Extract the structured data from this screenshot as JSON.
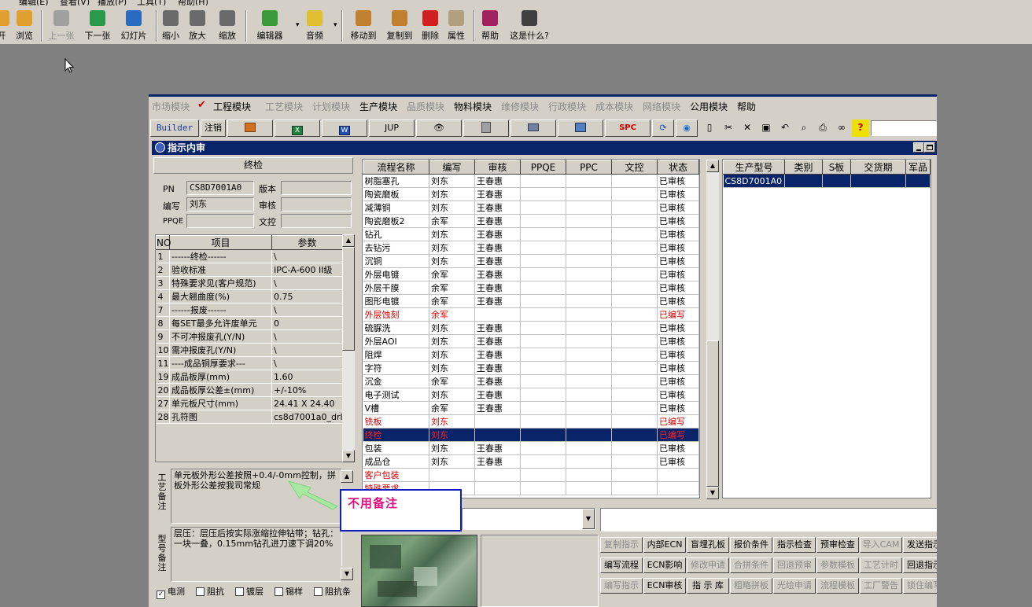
{
  "viewer": {
    "menu": [
      "编辑(E)",
      "查看(V)",
      "播放(P)",
      "工具(T)",
      "帮助(H)"
    ],
    "toolbar": [
      {
        "label": "开",
        "icon": "open-folder-icon",
        "color": "#e0a030"
      },
      {
        "label": "浏览",
        "icon": "browse-icon",
        "color": "#e0a030"
      },
      {
        "label": "上一张",
        "icon": "previous-icon",
        "color": "#a0a0a0",
        "disabled": true
      },
      {
        "label": "下一张",
        "icon": "next-icon",
        "color": "#2a9a4a"
      },
      {
        "label": "幻灯片",
        "icon": "slideshow-icon",
        "color": "#2a6ac0"
      },
      {
        "label": "缩小",
        "icon": "zoom-out-icon",
        "color": "#6a6a6a"
      },
      {
        "label": "放大",
        "icon": "zoom-in-icon",
        "color": "#6a6a6a"
      },
      {
        "label": "缩放",
        "icon": "zoom-icon",
        "color": "#6a6a6a"
      },
      {
        "label": "编辑器",
        "icon": "editor-icon",
        "color": "#3a9a3a"
      },
      {
        "label": "音频",
        "icon": "audio-icon",
        "color": "#e0c030"
      },
      {
        "label": "移动到",
        "icon": "move-to-icon",
        "color": "#c08030"
      },
      {
        "label": "复制到",
        "icon": "copy-to-icon",
        "color": "#c08030"
      },
      {
        "label": "删除",
        "icon": "delete-icon",
        "color": "#d02020"
      },
      {
        "label": "属性",
        "icon": "properties-icon",
        "color": "#b0a080"
      },
      {
        "label": "帮助",
        "icon": "help-book-icon",
        "color": "#a02060"
      },
      {
        "label": "这是什么?",
        "icon": "whats-this-icon",
        "color": "#404040"
      }
    ]
  },
  "app": {
    "modules": [
      {
        "label": "市场模块",
        "disabled": true
      },
      {
        "label": "工程模块",
        "disabled": false
      },
      {
        "label": "工艺模块",
        "disabled": true
      },
      {
        "label": "计划模块",
        "disabled": true
      },
      {
        "label": "生产模块",
        "disabled": false
      },
      {
        "label": "品质模块",
        "disabled": true
      },
      {
        "label": "物料模块",
        "disabled": false
      },
      {
        "label": "维修模块",
        "disabled": true
      },
      {
        "label": "行政模块",
        "disabled": true
      },
      {
        "label": "成本模块",
        "disabled": true
      },
      {
        "label": "网络模块",
        "disabled": true
      },
      {
        "label": "公用模块",
        "disabled": false
      },
      {
        "label": "帮助",
        "disabled": false
      }
    ],
    "toolbar": {
      "builder": "Builder",
      "logout": "注销",
      "jup": "JUP",
      "spc": "SPC"
    },
    "window_title": "指示内审",
    "form": {
      "section": "终检",
      "pn_label": "PN",
      "pn_value": "CS8D7001A0",
      "version_label": "版本",
      "version_value": "",
      "author_label": "编写",
      "author_value": "刘东",
      "review_label": "审核",
      "review_value": "",
      "ppqe_label": "PPQE",
      "ppqe_value": "",
      "doc_label": "文控",
      "doc_value": ""
    },
    "params": {
      "headers": [
        "NO",
        "项目",
        "参数"
      ],
      "rows": [
        [
          "1",
          "------终检------",
          "\\"
        ],
        [
          "2",
          "验收标准",
          "IPC-A-600 II级"
        ],
        [
          "3",
          "特殊要求见(客户规范)",
          "\\"
        ],
        [
          "4",
          "最大翘曲度(%)",
          "0.75"
        ],
        [
          "7",
          "------报废------",
          "\\"
        ],
        [
          "8",
          "每SET最多允许废单元",
          "0"
        ],
        [
          "9",
          "不可冲报废孔(Y/N)",
          "\\"
        ],
        [
          "10",
          "需冲报废孔(Y/N)",
          "\\"
        ],
        [
          "11",
          "----成品铜厚要求---",
          "\\"
        ],
        [
          "19",
          "成品板厚(mm)",
          "1.60"
        ],
        [
          "20",
          "成品板厚公差±(mm)",
          "+/-10%"
        ],
        [
          "27",
          "单元板尺寸(mm)",
          "24.41 X 24.40"
        ],
        [
          "28",
          "孔符图",
          "cs8d7001a0_drl"
        ]
      ]
    },
    "process_note_label": "工艺备注",
    "process_note": "单元板外形公差按照+0.4/-0mm控制，拼板外形公差按我司常规",
    "model_note_label": "型号备注",
    "model_note": "层压：层压后按实际涨缩拉伸钻带；钻孔：一块一叠，0.15mm钻孔进刀速下调20%",
    "checkboxes": [
      {
        "label": "电测",
        "checked": true
      },
      {
        "label": "阻抗",
        "checked": false
      },
      {
        "label": "镀层",
        "checked": false
      },
      {
        "label": "锡样",
        "checked": false
      },
      {
        "label": "阻抗条",
        "checked": false
      }
    ],
    "flow": {
      "headers": [
        "流程名称",
        "编写",
        "审核",
        "PPQE",
        "PPC",
        "文控",
        "状态"
      ],
      "rows": [
        {
          "cells": [
            "树脂塞孔",
            "刘东",
            "王春惠",
            "",
            "",
            "",
            "已审核"
          ],
          "style": "normal"
        },
        {
          "cells": [
            "陶瓷磨板",
            "刘东",
            "王春惠",
            "",
            "",
            "",
            "已审核"
          ],
          "style": "normal"
        },
        {
          "cells": [
            "减薄铜",
            "刘东",
            "王春惠",
            "",
            "",
            "",
            "已审核"
          ],
          "style": "normal"
        },
        {
          "cells": [
            "陶瓷磨板2",
            "余军",
            "王春惠",
            "",
            "",
            "",
            "已审核"
          ],
          "style": "normal"
        },
        {
          "cells": [
            "钻孔",
            "刘东",
            "王春惠",
            "",
            "",
            "",
            "已审核"
          ],
          "style": "normal"
        },
        {
          "cells": [
            "去钻污",
            "刘东",
            "王春惠",
            "",
            "",
            "",
            "已审核"
          ],
          "style": "normal"
        },
        {
          "cells": [
            "沉铜",
            "刘东",
            "王春惠",
            "",
            "",
            "",
            "已审核"
          ],
          "style": "normal"
        },
        {
          "cells": [
            "外层电镀",
            "余军",
            "王春惠",
            "",
            "",
            "",
            "已审核"
          ],
          "style": "normal"
        },
        {
          "cells": [
            "外层干膜",
            "余军",
            "王春惠",
            "",
            "",
            "",
            "已审核"
          ],
          "style": "normal"
        },
        {
          "cells": [
            "图形电镀",
            "余军",
            "王春惠",
            "",
            "",
            "",
            "已审核"
          ],
          "style": "normal"
        },
        {
          "cells": [
            "外层蚀刻",
            "余军",
            "",
            "",
            "",
            "",
            "已编写"
          ],
          "style": "red"
        },
        {
          "cells": [
            "硫脲洗",
            "刘东",
            "王春惠",
            "",
            "",
            "",
            "已审核"
          ],
          "style": "normal"
        },
        {
          "cells": [
            "外层AOI",
            "刘东",
            "王春惠",
            "",
            "",
            "",
            "已审核"
          ],
          "style": "normal"
        },
        {
          "cells": [
            "阻焊",
            "刘东",
            "王春惠",
            "",
            "",
            "",
            "已审核"
          ],
          "style": "normal"
        },
        {
          "cells": [
            "字符",
            "刘东",
            "王春惠",
            "",
            "",
            "",
            "已审核"
          ],
          "style": "normal"
        },
        {
          "cells": [
            "沉金",
            "余军",
            "王春惠",
            "",
            "",
            "",
            "已审核"
          ],
          "style": "normal"
        },
        {
          "cells": [
            "电子测试",
            "刘东",
            "王春惠",
            "",
            "",
            "",
            "已审核"
          ],
          "style": "normal"
        },
        {
          "cells": [
            "V槽",
            "余军",
            "王春惠",
            "",
            "",
            "",
            "已审核"
          ],
          "style": "normal"
        },
        {
          "cells": [
            "铣板",
            "刘东",
            "",
            "",
            "",
            "",
            "已编写"
          ],
          "style": "red"
        },
        {
          "cells": [
            "终检",
            "刘东",
            "",
            "",
            "",
            "",
            "已编写"
          ],
          "style": "selected"
        },
        {
          "cells": [
            "包装",
            "刘东",
            "王春惠",
            "",
            "",
            "",
            "已审核"
          ],
          "style": "normal"
        },
        {
          "cells": [
            "成品仓",
            "刘东",
            "王春惠",
            "",
            "",
            "",
            "已审核"
          ],
          "style": "normal"
        },
        {
          "cells": [
            "客户包装",
            "",
            "",
            "",
            "",
            "",
            ""
          ],
          "style": "red"
        },
        {
          "cells": [
            "特殊要求",
            "",
            "",
            "",
            "",
            "",
            ""
          ],
          "style": "red"
        }
      ]
    },
    "production": {
      "headers": [
        "生产型号",
        "类别",
        "S板",
        "交货期",
        "军品"
      ],
      "rows": [
        [
          "CS8D7001A0",
          "",
          "",
          "",
          ""
        ]
      ]
    },
    "annotation": "不用备注",
    "actions": [
      [
        {
          "label": "复制指示",
          "d": true
        },
        {
          "label": "内部ECN",
          "d": false
        },
        {
          "label": "盲埋孔板",
          "d": false
        },
        {
          "label": "报价条件",
          "d": false
        },
        {
          "label": "指示检查",
          "d": false
        },
        {
          "label": "预审检查",
          "d": false
        },
        {
          "label": "导入CAM",
          "d": true
        },
        {
          "label": "发送指示",
          "d": false
        }
      ],
      [
        {
          "label": "编写流程",
          "d": false
        },
        {
          "label": "ECN影响",
          "d": false
        },
        {
          "label": "修改申请",
          "d": true
        },
        {
          "label": "合拼条件",
          "d": true
        },
        {
          "label": "回退预审",
          "d": true
        },
        {
          "label": "参数模板",
          "d": true
        },
        {
          "label": "工艺计时",
          "d": true
        },
        {
          "label": "回退指示",
          "d": false
        }
      ],
      [
        {
          "label": "编写指示",
          "d": true
        },
        {
          "label": "ECN审核",
          "d": false
        },
        {
          "label": "指 示 库",
          "d": false
        },
        {
          "label": "粗略拼板",
          "d": true
        },
        {
          "label": "光绘申请",
          "d": true
        },
        {
          "label": "流程模板",
          "d": true
        },
        {
          "label": "工厂警告",
          "d": true
        },
        {
          "label": "锁住编写",
          "d": true
        }
      ]
    ]
  }
}
